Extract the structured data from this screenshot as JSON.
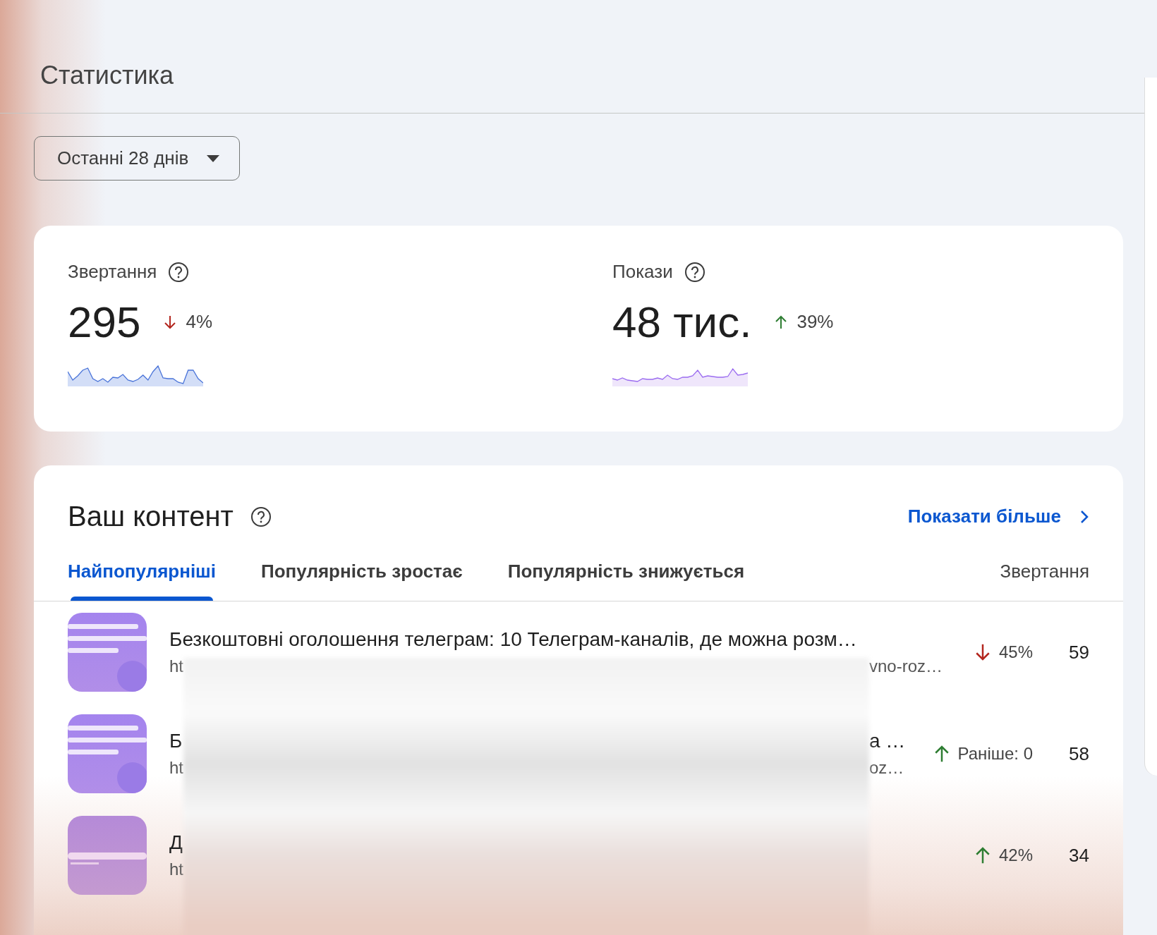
{
  "header": {
    "title": "Статистика"
  },
  "period": {
    "label": "Останні 28 днів"
  },
  "metrics": [
    {
      "label": "Звертання",
      "value": "295",
      "change": "4%",
      "rising": false
    },
    {
      "label": "Покази",
      "value": "48 тис.",
      "change": "39%",
      "rising": true
    }
  ],
  "content": {
    "title": "Ваш контент",
    "more_link": "Показати більше",
    "tabs": [
      {
        "label": "Найпопулярніші",
        "selected": true
      },
      {
        "label": "Популярність зростає",
        "selected": false
      },
      {
        "label": "Популярність знижується",
        "selected": false
      }
    ],
    "column_header": "Звертання",
    "rows": [
      {
        "title_start": "Безкоштовні оголошення телеграм: 10 Телеграм-каналів, де можна розм…",
        "url_start": "ht",
        "url_end": "vno-roz…",
        "change": "45%",
        "rising": false,
        "count": "59"
      },
      {
        "title_start": "Б",
        "title_end": "а …",
        "url_start": "ht",
        "url_end": "oz…",
        "change": "Раніше: 0",
        "rising": true,
        "count": "58"
      },
      {
        "title_start": "Д",
        "url_start": "ht",
        "change": "42%",
        "rising": true,
        "count": "34"
      }
    ]
  }
}
